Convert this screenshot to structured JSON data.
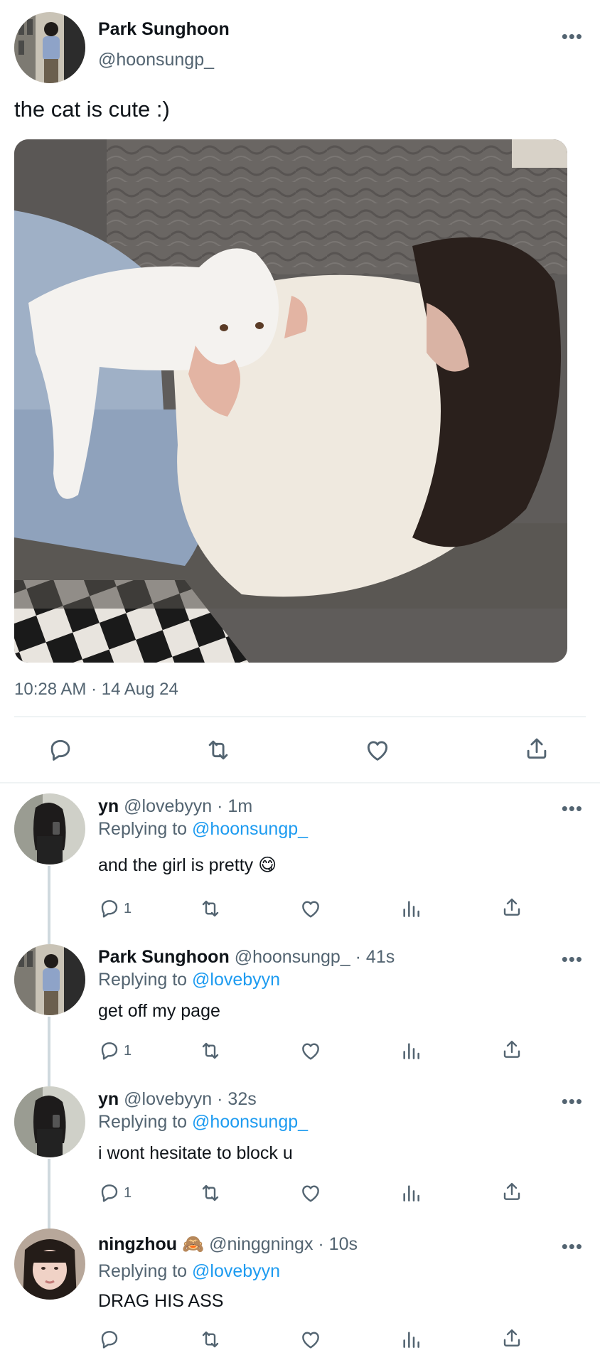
{
  "main_tweet": {
    "author_name": "Park Sunghoon",
    "author_handle": "@hoonsungp_",
    "text": "the cat is cute :)",
    "timestamp": "10:28 AM · 14 Aug 24",
    "more_label": "•••"
  },
  "replies": [
    {
      "name": "yn",
      "handle": "@lovebyyn",
      "time": "· 1m",
      "replying_prefix": "Replying to",
      "replying_to": "@hoonsungp_",
      "text": "and the girl is pretty",
      "emoji": "😋",
      "reply_count": "1"
    },
    {
      "name": "Park Sunghoon",
      "handle": "@hoonsungp_",
      "time": "· 41s",
      "replying_prefix": "Replying to",
      "replying_to": "@lovebyyn",
      "text": "get off my page",
      "reply_count": "1"
    },
    {
      "name": "yn",
      "handle": "@lovebyyn",
      "time": "· 32s",
      "replying_prefix": "Replying to",
      "replying_to": "@hoonsungp_",
      "text": "i wont hesitate to block u",
      "reply_count": "1"
    },
    {
      "name": "ningzhou",
      "name_emoji": "🙈",
      "handle": "@ninggningx",
      "time": "· 10s",
      "replying_prefix": "Replying to",
      "replying_to": "@lovebyyn",
      "text": "DRAG HIS ASS",
      "reply_count": ""
    }
  ],
  "colors": {
    "link": "#1d9bf0",
    "muted": "#536471",
    "divider": "#eff3f4"
  },
  "icons": [
    "reply-icon",
    "retweet-icon",
    "like-icon",
    "views-icon",
    "share-icon",
    "more-icon"
  ]
}
